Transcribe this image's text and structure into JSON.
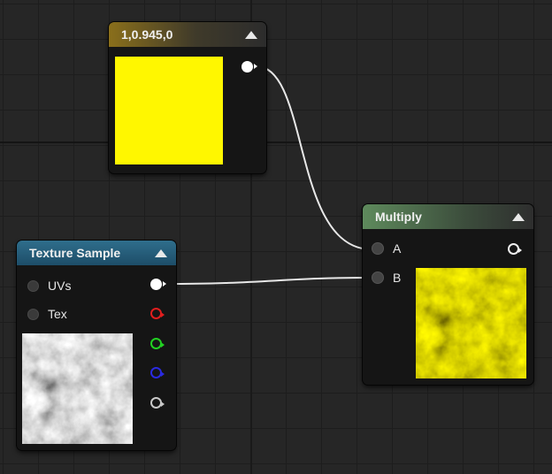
{
  "nodes": {
    "constant": {
      "title": "1,0.945,0",
      "color": "#fff700"
    },
    "texture": {
      "title": "Texture Sample",
      "inputs": [
        "UVs",
        "Tex"
      ],
      "outputs": [
        "rgb",
        "r",
        "g",
        "b",
        "a"
      ]
    },
    "multiply": {
      "title": "Multiply",
      "inputs": [
        "A",
        "B"
      ],
      "tint": "#e8d400"
    }
  },
  "colors": {
    "canvas_bg": "#262626",
    "wire": "#e8e8e8",
    "constant_header": "#8a6f1b",
    "texture_header": "#2f6e8c",
    "multiply_header": "#5e8a5c"
  },
  "icons": {
    "collapse": "triangle-up-icon",
    "pin_in": "circle-pin-icon",
    "pin_out": "arrow-circle-pin-icon"
  }
}
